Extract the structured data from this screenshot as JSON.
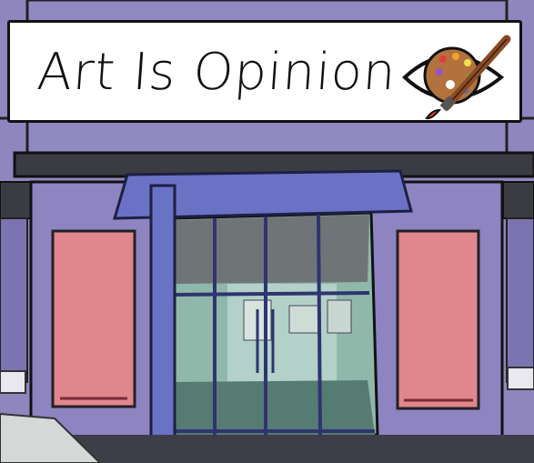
{
  "shop": {
    "sign_text": "Art Is Opinion",
    "logo_icon": "eye-palette-paintbrush-icon"
  },
  "colors": {
    "wall": "#8f86c0",
    "wall_dark": "#3a3a46",
    "awning": "#6a72c6",
    "pink_panel": "#e0868d",
    "glass": "#8fb7aa",
    "sign_bg": "#ffffff"
  }
}
